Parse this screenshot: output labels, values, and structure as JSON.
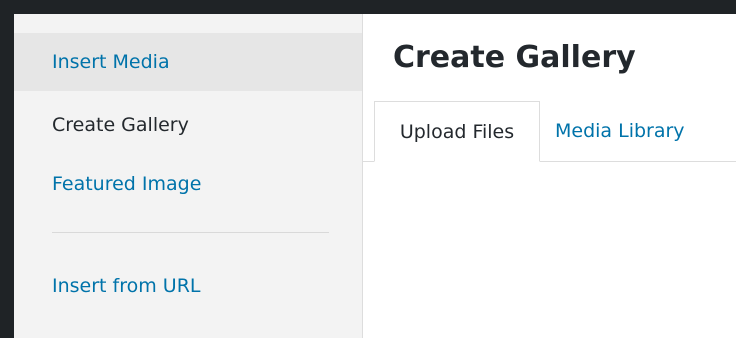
{
  "sidebar": {
    "items": [
      {
        "label": "Insert Media"
      },
      {
        "label": "Create Gallery"
      },
      {
        "label": "Featured Image"
      },
      {
        "label": "Insert from URL"
      }
    ]
  },
  "main": {
    "title": "Create Gallery",
    "tabs": [
      {
        "label": "Upload Files"
      },
      {
        "label": "Media Library"
      }
    ]
  },
  "colors": {
    "link": "#0073aa",
    "text": "#23282d",
    "sidebar_bg": "#f3f3f3",
    "background_dark": "#1f2326"
  }
}
